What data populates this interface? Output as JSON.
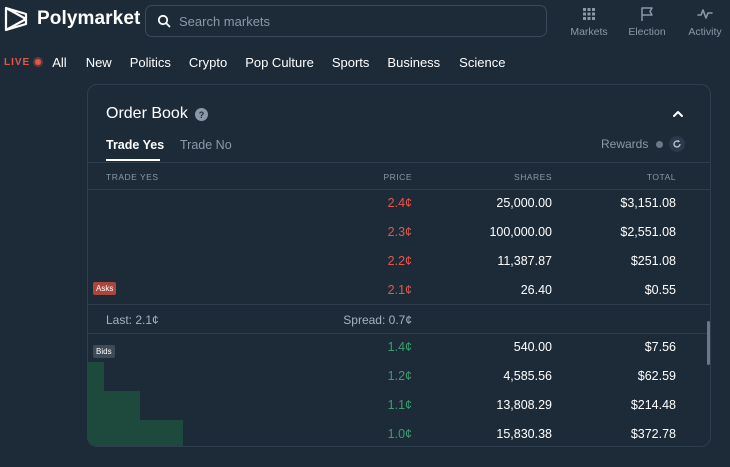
{
  "brand": {
    "name": "Polymarket"
  },
  "search": {
    "placeholder": "Search markets"
  },
  "nav_icons": [
    {
      "label": "Markets",
      "icon": "grid-icon"
    },
    {
      "label": "Election",
      "icon": "flag-icon"
    },
    {
      "label": "Activity",
      "icon": "pulse-icon"
    }
  ],
  "categories": {
    "live_label": "LIVE",
    "items": [
      "All",
      "New",
      "Politics",
      "Crypto",
      "Pop Culture",
      "Sports",
      "Business",
      "Science"
    ]
  },
  "order_book": {
    "title": "Order Book",
    "tabs": {
      "yes": "Trade Yes",
      "no": "Trade No"
    },
    "rewards_label": "Rewards",
    "columns": {
      "side": "TRADE YES",
      "price": "PRICE",
      "shares": "SHARES",
      "total": "TOTAL"
    },
    "asks_badge": "Asks",
    "bids_badge": "Bids",
    "asks": [
      {
        "price": "2.4¢",
        "shares": "25,000.00",
        "total": "$3,151.08"
      },
      {
        "price": "2.3¢",
        "shares": "100,000.00",
        "total": "$2,551.08"
      },
      {
        "price": "2.2¢",
        "shares": "11,387.87",
        "total": "$251.08"
      },
      {
        "price": "2.1¢",
        "shares": "26.40",
        "total": "$0.55"
      }
    ],
    "last": "Last: 2.1¢",
    "spread": "Spread: 0.7¢",
    "bids": [
      {
        "price": "1.4¢",
        "shares": "540.00",
        "total": "$7.56"
      },
      {
        "price": "1.2¢",
        "shares": "4,585.56",
        "total": "$62.59"
      },
      {
        "price": "1.1¢",
        "shares": "13,808.29",
        "total": "$214.48"
      },
      {
        "price": "1.0¢",
        "shares": "15,830.38",
        "total": "$372.78"
      }
    ]
  },
  "colors": {
    "ask": "#e2574c",
    "bid": "#3c9d6e",
    "background": "#1d2b39"
  }
}
